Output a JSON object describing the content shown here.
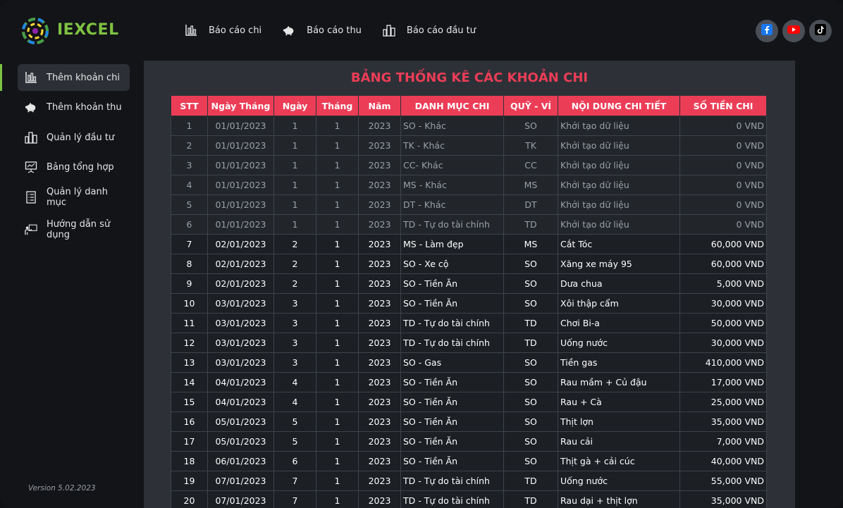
{
  "brand": {
    "name": "IEXCEL"
  },
  "topnav": [
    {
      "label": "Báo cáo chi",
      "icon": "bar-chart-icon"
    },
    {
      "label": "Báo cáo thu",
      "icon": "piggy-bank-icon"
    },
    {
      "label": "Báo cáo đầu tư",
      "icon": "buildings-icon"
    }
  ],
  "social": [
    {
      "icon": "facebook-icon",
      "color": "#1877f2"
    },
    {
      "icon": "youtube-icon",
      "color": "#ff0000"
    },
    {
      "icon": "tiktok-icon",
      "color": "#000000"
    }
  ],
  "sidebar": {
    "items": [
      {
        "label": "Thêm khoản chi",
        "icon": "chart-icon",
        "active": true
      },
      {
        "label": "Thêm khoản thu",
        "icon": "piggy-bank-icon"
      },
      {
        "label": "Quản lý đầu tư",
        "icon": "buildings-icon"
      },
      {
        "label": "Bảng tổng hợp",
        "icon": "presentation-icon"
      },
      {
        "label": "Quản lý danh mục",
        "icon": "list-icon"
      },
      {
        "label": "Hướng dẫn sử dụng",
        "icon": "teacher-icon"
      }
    ],
    "version": "Version 5.02.2023"
  },
  "main": {
    "title": "BẢNG THỐNG KÊ CÁC KHOẢN CHI",
    "columns": [
      "STT",
      "Ngày Tháng",
      "Ngày",
      "Tháng",
      "Năm",
      "DANH MỤC CHI",
      "QUỸ - VÍ",
      "NỘI DUNG CHI TIẾT",
      "SỐ TIỀN CHI"
    ],
    "rows": [
      [
        "1",
        "01/01/2023",
        "1",
        "1",
        "2023",
        "SO - Khác",
        "SO",
        "Khởi tạo dữ liệu",
        "0 VND"
      ],
      [
        "2",
        "01/01/2023",
        "1",
        "1",
        "2023",
        "TK - Khác",
        "TK",
        "Khởi tạo dữ liệu",
        "0 VND"
      ],
      [
        "3",
        "01/01/2023",
        "1",
        "1",
        "2023",
        "CC- Khác",
        "CC",
        "Khởi tạo dữ liệu",
        "0 VND"
      ],
      [
        "4",
        "01/01/2023",
        "1",
        "1",
        "2023",
        "MS - Khác",
        "MS",
        "Khởi tạo dữ liệu",
        "0 VND"
      ],
      [
        "5",
        "01/01/2023",
        "1",
        "1",
        "2023",
        "DT - Khác",
        "DT",
        "Khởi tạo dữ liệu",
        "0 VND"
      ],
      [
        "6",
        "01/01/2023",
        "1",
        "1",
        "2023",
        "TD - Tự do tài chính",
        "TD",
        "Khởi tạo dữ liệu",
        "0 VND"
      ],
      [
        "7",
        "02/01/2023",
        "2",
        "1",
        "2023",
        "MS - Làm đẹp",
        "MS",
        "Cắt Tóc",
        "60,000 VND"
      ],
      [
        "8",
        "02/01/2023",
        "2",
        "1",
        "2023",
        "SO - Xe cộ",
        "SO",
        "Xăng xe máy 95",
        "60,000 VND"
      ],
      [
        "9",
        "02/01/2023",
        "2",
        "1",
        "2023",
        "SO - Tiền Ăn",
        "SO",
        "Dưa chua",
        "5,000 VND"
      ],
      [
        "10",
        "03/01/2023",
        "3",
        "1",
        "2023",
        "SO - Tiền Ăn",
        "SO",
        "Xôi thập cẩm",
        "30,000 VND"
      ],
      [
        "11",
        "03/01/2023",
        "3",
        "1",
        "2023",
        "TD - Tự do tài chính",
        "TD",
        "Chơi Bi-a",
        "50,000 VND"
      ],
      [
        "12",
        "03/01/2023",
        "3",
        "1",
        "2023",
        "TD - Tự do tài chính",
        "TD",
        "Uống nước",
        "30,000 VND"
      ],
      [
        "13",
        "03/01/2023",
        "3",
        "1",
        "2023",
        "SO - Gas",
        "SO",
        "Tiền gas",
        "410,000 VND"
      ],
      [
        "14",
        "04/01/2023",
        "4",
        "1",
        "2023",
        "SO - Tiền Ăn",
        "SO",
        "Rau mầm + Củ đậu",
        "17,000 VND"
      ],
      [
        "15",
        "04/01/2023",
        "4",
        "1",
        "2023",
        "SO - Tiền Ăn",
        "SO",
        "Rau + Cà",
        "25,000 VND"
      ],
      [
        "16",
        "05/01/2023",
        "5",
        "1",
        "2023",
        "SO - Tiền Ăn",
        "SO",
        "Thịt lợn",
        "35,000 VND"
      ],
      [
        "17",
        "05/01/2023",
        "5",
        "1",
        "2023",
        "SO - Tiền Ăn",
        "SO",
        "Rau cải",
        "7,000 VND"
      ],
      [
        "18",
        "06/01/2023",
        "6",
        "1",
        "2023",
        "SO - Tiền Ăn",
        "SO",
        "Thịt gà + cải cúc",
        "40,000 VND"
      ],
      [
        "19",
        "07/01/2023",
        "7",
        "1",
        "2023",
        "TD - Tự do tài chính",
        "TD",
        "Uống nước",
        "55,000 VND"
      ],
      [
        "20",
        "07/01/2023",
        "7",
        "1",
        "2023",
        "TD - Tự do tài chính",
        "TD",
        "Rau dại + thịt lợn",
        "35,000 VND"
      ]
    ]
  }
}
